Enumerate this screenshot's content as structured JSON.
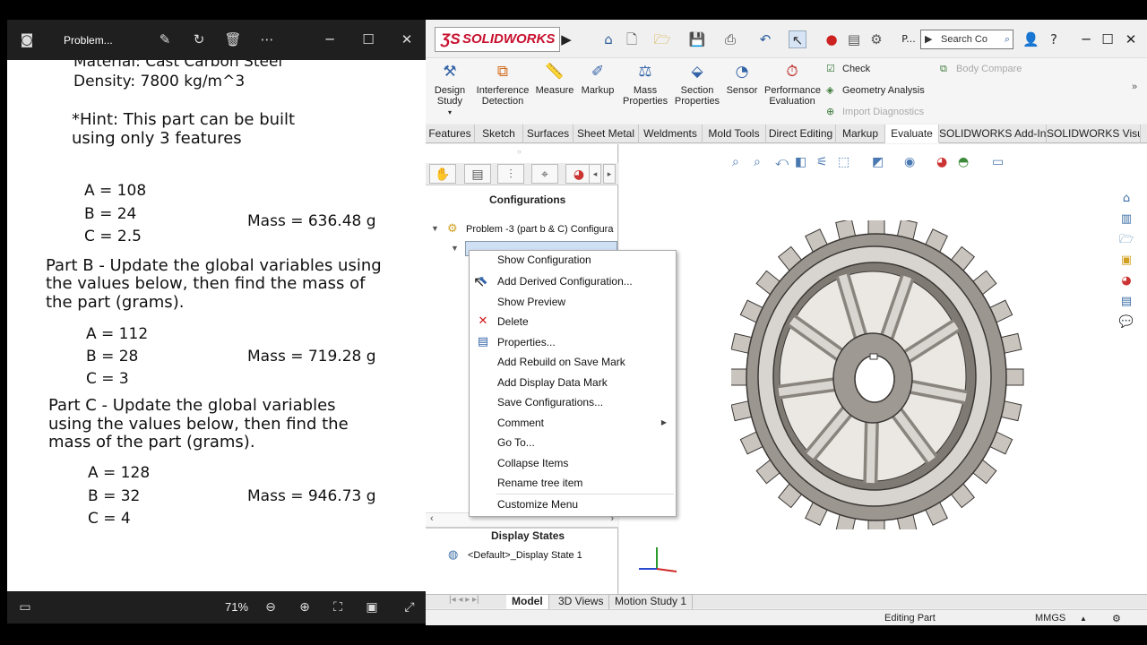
{
  "photos": {
    "title": "Problem...",
    "zoom": "71%",
    "doc": {
      "cut_line": "Material: Cast Carbon Steel",
      "density": "Density: 7800 kg/m^3",
      "hint1": "*Hint: This part can be built",
      "hint2": "using only 3 features",
      "a1": "A = 108",
      "b1": "B = 24",
      "c1": "C = 2.5",
      "mass1": "Mass = 636.48 g",
      "partb1": "Part B - Update the global variables using",
      "partb2": "the values below, then find the mass of",
      "partb3": "the part (grams).",
      "a2": "A = 112",
      "b2": "B = 28",
      "c2": "C = 3",
      "mass2": "Mass = 719.28 g",
      "partc1": "Part C - Update the global variables",
      "partc2": "using the values below, then find the",
      "partc3": "mass of the part (grams).",
      "a3": "A = 128",
      "b3": "B = 32",
      "c3": "C = 4",
      "mass3": "Mass = 946.73 g"
    }
  },
  "sw": {
    "logo": "SOLIDWORKS",
    "title_short": "P...",
    "search_placeholder": "Search Co",
    "commands": {
      "design_study": [
        "Design",
        "Study"
      ],
      "interference": [
        "Interference",
        "Detection"
      ],
      "measure": "Measure",
      "markup": "Markup",
      "mass_props": [
        "Mass",
        "Properties"
      ],
      "section_props": [
        "Section",
        "Properties"
      ],
      "sensor": "Sensor",
      "perf_eval": [
        "Performance",
        "Evaluation"
      ],
      "check": "Check",
      "geometry_analysis": "Geometry Analysis",
      "import_diag": "Import Diagnostics",
      "body_compare": "Body Compare"
    },
    "tabs": [
      "Features",
      "Sketch",
      "Surfaces",
      "Sheet Metal",
      "Weldments",
      "Mold Tools",
      "Direct Editing",
      "Markup",
      "Evaluate",
      "SOLIDWORKS Add-Ins",
      "SOLIDWORKS Visu..."
    ],
    "active_tab": "Evaluate",
    "panel": {
      "configurations_header": "Configurations",
      "tree_root": "Problem -3 (part b & C) Configura",
      "display_states_header": "Display States",
      "display_state_item": "<Default>_Display State 1"
    },
    "context_menu": [
      {
        "label": "Show Configuration",
        "icon": ""
      },
      {
        "label": "Add Derived Configuration...",
        "icon": "add-derived-icon"
      },
      {
        "label": "Show Preview",
        "icon": ""
      },
      {
        "label": "Delete",
        "icon": "delete-x-icon"
      },
      {
        "label": "Properties...",
        "icon": "properties-icon"
      },
      {
        "label": "Add Rebuild on Save Mark",
        "icon": ""
      },
      {
        "label": "Add Display Data Mark",
        "icon": ""
      },
      {
        "label": "Save Configurations...",
        "icon": ""
      },
      {
        "label": "Comment",
        "icon": ""
      },
      {
        "label": "Go To...",
        "icon": ""
      },
      {
        "label": "Collapse Items",
        "icon": ""
      },
      {
        "label": "Rename tree item",
        "icon": ""
      },
      {
        "label": "Customize Menu",
        "icon": ""
      }
    ],
    "bottom_tabs": [
      "Model",
      "3D Views",
      "Motion Study 1"
    ],
    "status": {
      "mode": "Editing Part",
      "units": "MMGS"
    },
    "colors": {
      "logo_red": "#c8102e",
      "gear": "#8a8580",
      "accent_blue": "#3464a8"
    }
  }
}
